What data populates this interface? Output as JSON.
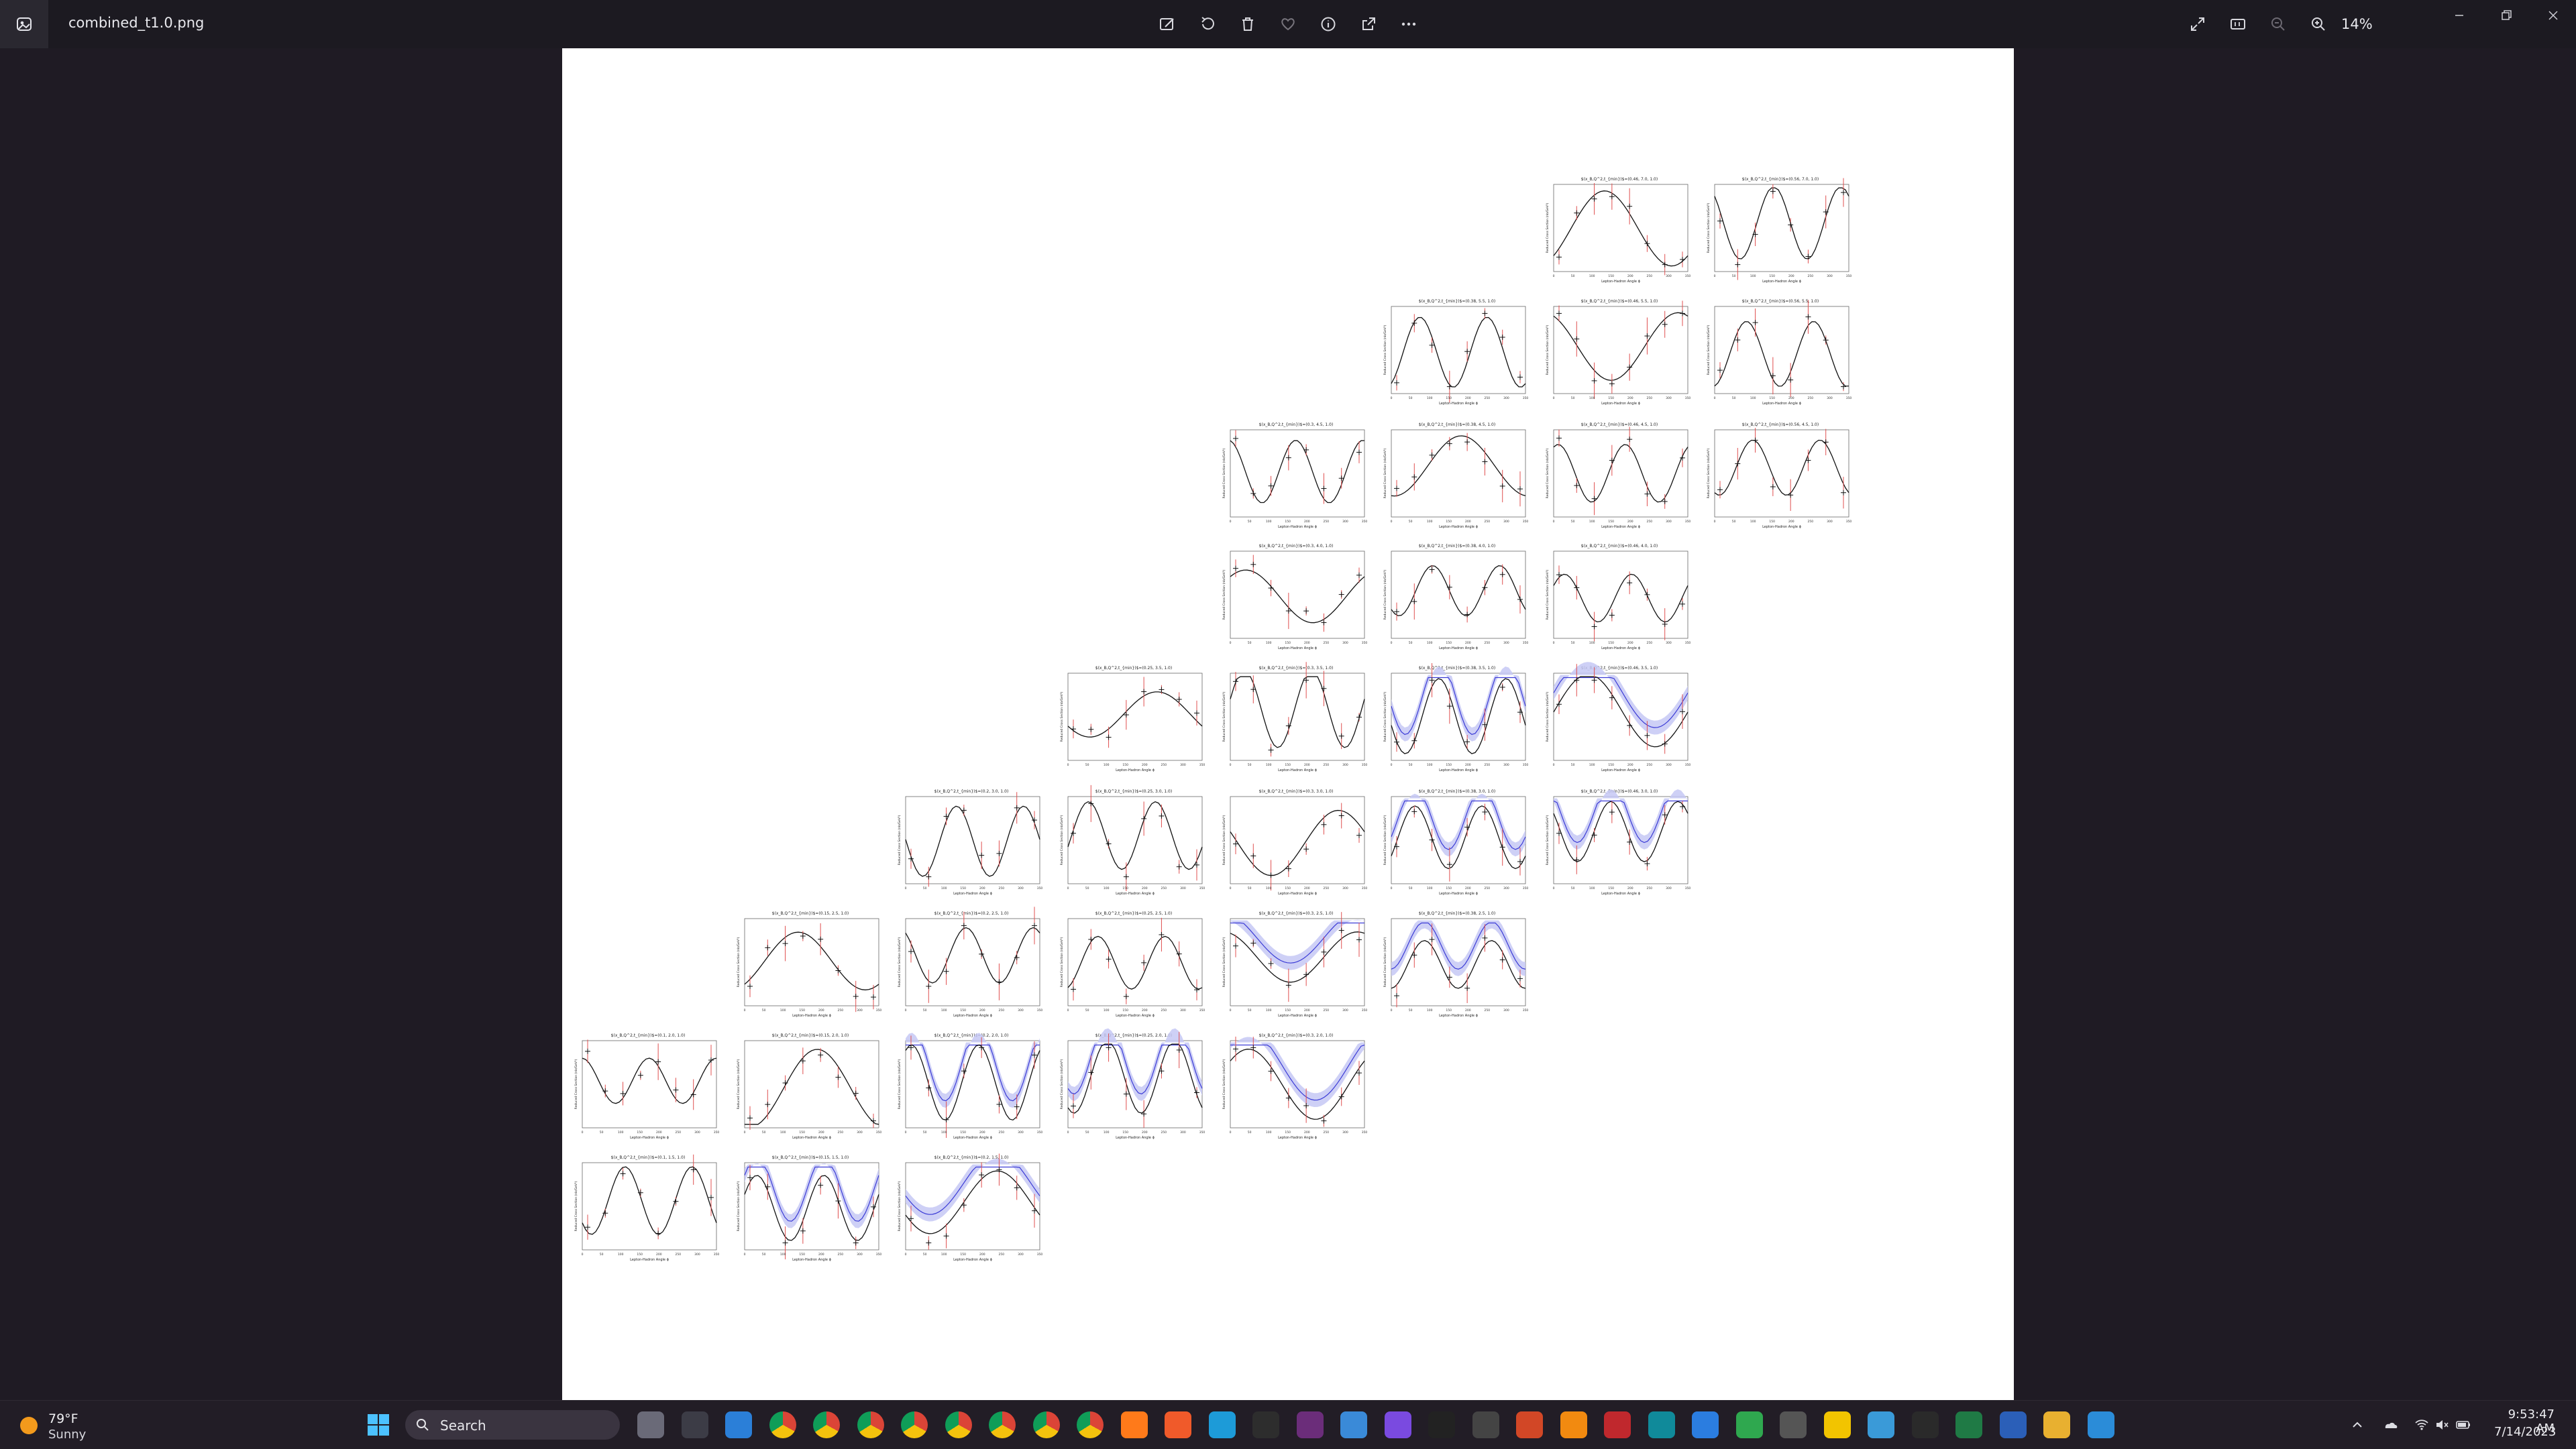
{
  "window": {
    "file_name": "combined_t1.0.png",
    "zoom": "14%"
  },
  "toolbar": [
    {
      "name": "edit-image-button",
      "icon": "edit-image-icon"
    },
    {
      "name": "rotate-button",
      "icon": "rotate-icon"
    },
    {
      "name": "delete-button",
      "icon": "trash-icon"
    },
    {
      "name": "favorite-button",
      "icon": "heart-icon"
    },
    {
      "name": "info-button",
      "icon": "info-icon"
    },
    {
      "name": "share-button",
      "icon": "share-icon"
    },
    {
      "name": "more-button",
      "icon": "more-icon"
    }
  ],
  "plot_grid": {
    "xlabel": "Lepton-Hadron Angle ϕ",
    "ylabel": "Reduced Cross Section (nb/GeV²)",
    "x_ticks": [
      "0",
      "50",
      "100",
      "150",
      "200",
      "250",
      "300",
      "350"
    ],
    "panels": [
      {
        "title": "$(x_B,Q^2,t_{min})$=(0.46, 7.0, 1.0)",
        "errors": "red",
        "band": false
      },
      {
        "title": "$(x_B,Q^2,t_{min})$=(0.56, 7.0, 1.0)",
        "errors": "red",
        "band": false
      },
      {
        "title": "$(x_B,Q^2,t_{min})$=(0.38, 5.5, 1.0)",
        "errors": "red",
        "band": false
      },
      {
        "title": "$(x_B,Q^2,t_{min})$=(0.46, 5.5, 1.0)",
        "errors": "red",
        "band": false
      },
      {
        "title": "$(x_B,Q^2,t_{min})$=(0.56, 5.5, 1.0)",
        "errors": "red",
        "band": false
      },
      {
        "title": "$(x_B,Q^2,t_{min})$=(0.3, 4.5, 1.0)",
        "errors": "red",
        "band": false
      },
      {
        "title": "$(x_B,Q^2,t_{min})$=(0.38, 4.5, 1.0)",
        "errors": "red",
        "band": false
      },
      {
        "title": "$(x_B,Q^2,t_{min})$=(0.46, 4.5, 1.0)",
        "errors": "red",
        "band": false
      },
      {
        "title": "$(x_B,Q^2,t_{min})$=(0.56, 4.5, 1.0)",
        "errors": "red",
        "band": false
      },
      {
        "title": "$(x_B,Q^2,t_{min})$=(0.3, 4.0, 1.0)",
        "errors": "red",
        "band": false
      },
      {
        "title": "$(x_B,Q^2,t_{min})$=(0.38, 4.0, 1.0)",
        "errors": "red",
        "band": false
      },
      {
        "title": "$(x_B,Q^2,t_{min})$=(0.46, 4.0, 1.0)",
        "errors": "red",
        "band": false
      },
      {
        "title": "$(x_B,Q^2,t_{min})$=(0.25, 3.5, 1.0)",
        "errors": "red",
        "band": false
      },
      {
        "title": "$(x_B,Q^2,t_{min})$=(0.3, 3.5, 1.0)",
        "errors": "red",
        "band": false
      },
      {
        "title": "$(x_B,Q^2,t_{min})$=(0.38, 3.5, 1.0)",
        "errors": "red",
        "band": true
      },
      {
        "title": "$(x_B,Q^2,t_{min})$=(0.46, 3.5, 1.0)",
        "errors": "red",
        "band": true
      },
      {
        "title": "$(x_B,Q^2,t_{min})$=(0.2, 3.0, 1.0)",
        "errors": "red",
        "band": false
      },
      {
        "title": "$(x_B,Q^2,t_{min})$=(0.25, 3.0, 1.0)",
        "errors": "red",
        "band": false
      },
      {
        "title": "$(x_B,Q^2,t_{min})$=(0.3, 3.0, 1.0)",
        "errors": "red",
        "band": false
      },
      {
        "title": "$(x_B,Q^2,t_{min})$=(0.38, 3.0, 1.0)",
        "errors": "red",
        "band": true
      },
      {
        "title": "$(x_B,Q^2,t_{min})$=(0.46, 3.0, 1.0)",
        "errors": "red",
        "band": true
      },
      {
        "title": "$(x_B,Q^2,t_{min})$=(0.15, 2.5, 1.0)",
        "errors": "red",
        "band": false
      },
      {
        "title": "$(x_B,Q^2,t_{min})$=(0.2, 2.5, 1.0)",
        "errors": "red",
        "band": false
      },
      {
        "title": "$(x_B,Q^2,t_{min})$=(0.25, 2.5, 1.0)",
        "errors": "red",
        "band": false
      },
      {
        "title": "$(x_B,Q^2,t_{min})$=(0.3, 2.5, 1.0)",
        "errors": "red",
        "band": true
      },
      {
        "title": "$(x_B,Q^2,t_{min})$=(0.38, 2.5, 1.0)",
        "errors": "red",
        "band": true
      },
      {
        "title": "$(x_B,Q^2,t_{min})$=(0.1, 2.0, 1.0)",
        "errors": "red",
        "band": false
      },
      {
        "title": "$(x_B,Q^2,t_{min})$=(0.15, 2.0, 1.0)",
        "errors": "red",
        "band": false
      },
      {
        "title": "$(x_B,Q^2,t_{min})$=(0.2, 2.0, 1.0)",
        "errors": "red",
        "band": true
      },
      {
        "title": "$(x_B,Q^2,t_{min})$=(0.25, 2.0, 1.0)",
        "errors": "red",
        "band": true
      },
      {
        "title": "$(x_B,Q^2,t_{min})$=(0.3, 2.0, 1.0)",
        "errors": "red",
        "band": true
      },
      {
        "title": "$(x_B,Q^2,t_{min})$=(0.1, 1.5, 1.0)",
        "errors": "red",
        "band": false
      },
      {
        "title": "$(x_B,Q^2,t_{min})$=(0.15, 1.5, 1.0)",
        "errors": "red",
        "band": true
      },
      {
        "title": "$(x_B,Q^2,t_{min})$=(0.2, 1.5, 1.0)",
        "errors": "red",
        "band": true
      }
    ]
  },
  "taskbar": {
    "weather_temp": "79°F",
    "weather_condition": "Sunny",
    "search_label": "Search",
    "apps": [
      "file-explorer",
      "terminal",
      "vscode",
      "chrome",
      "chrome",
      "chrome",
      "chrome",
      "chrome",
      "chrome",
      "chrome",
      "chrome",
      "firefox",
      "brave",
      "edge",
      "notion",
      "slack",
      "mail",
      "tor",
      "screen-recorder",
      "unity",
      "powerpoint",
      "vlc",
      "solidworks",
      "arduino",
      "dropbox",
      "chart-app",
      "game-app",
      "favorites",
      "clock",
      "notepad",
      "excel",
      "word",
      "folder",
      "photos"
    ],
    "time": "9:53:47 AM",
    "date": "7/14/2023"
  },
  "colors": {
    "background": "#1f1b24",
    "titlebar": "#1c1a21",
    "taskbar": "#221d26",
    "error_bar": "#e05050",
    "band_fill": "#c6c8f4",
    "band_line": "#3b3bd6"
  }
}
